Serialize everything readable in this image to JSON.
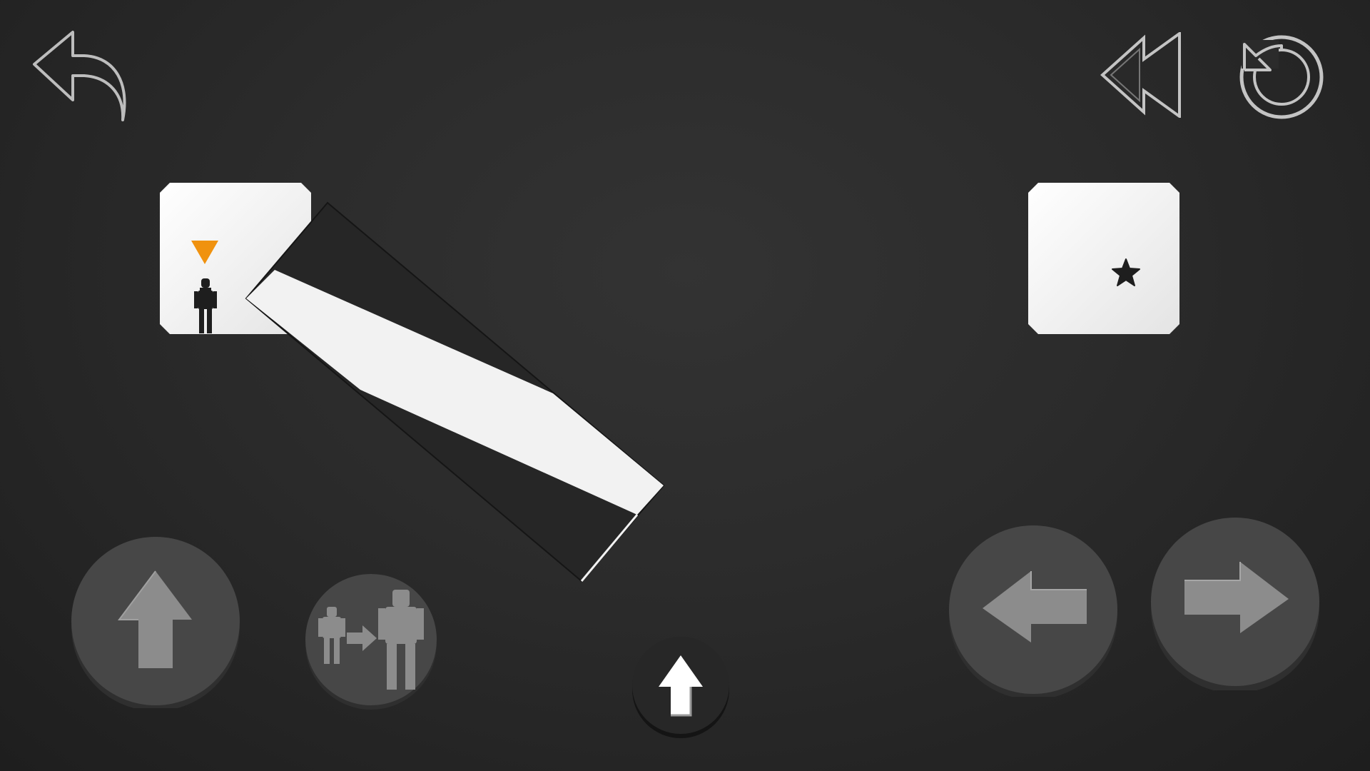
{
  "game": {
    "screen": "level",
    "colors": {
      "background": "#2a2a2a",
      "tile": "#f1f1f1",
      "tile_dark": "#262626",
      "accent": "#f0920f",
      "button_fill": "#454545",
      "button_shadow": "#2f2f2f",
      "button_icon": "#8a8a8a",
      "outline_icon": "#c4c4c4",
      "character": "#1e1e1e"
    }
  },
  "top_bar": {
    "back_icon": "back-arrow-icon",
    "rewind_icon": "rewind-icon",
    "restart_icon": "restart-icon"
  },
  "board": {
    "start_tile": {
      "marker_icon": "orange-triangle-marker",
      "character_icon": "stick-figure-icon"
    },
    "goal_tile": {
      "goal_icon": "star-icon"
    },
    "rotating_tile": {
      "state": "rotated"
    }
  },
  "controls": {
    "jump_icon": "up-arrow-icon",
    "grow_icon": "grow-character-icon",
    "center_icon": "up-arrow-icon",
    "left_icon": "left-arrow-icon",
    "right_icon": "right-arrow-icon"
  }
}
